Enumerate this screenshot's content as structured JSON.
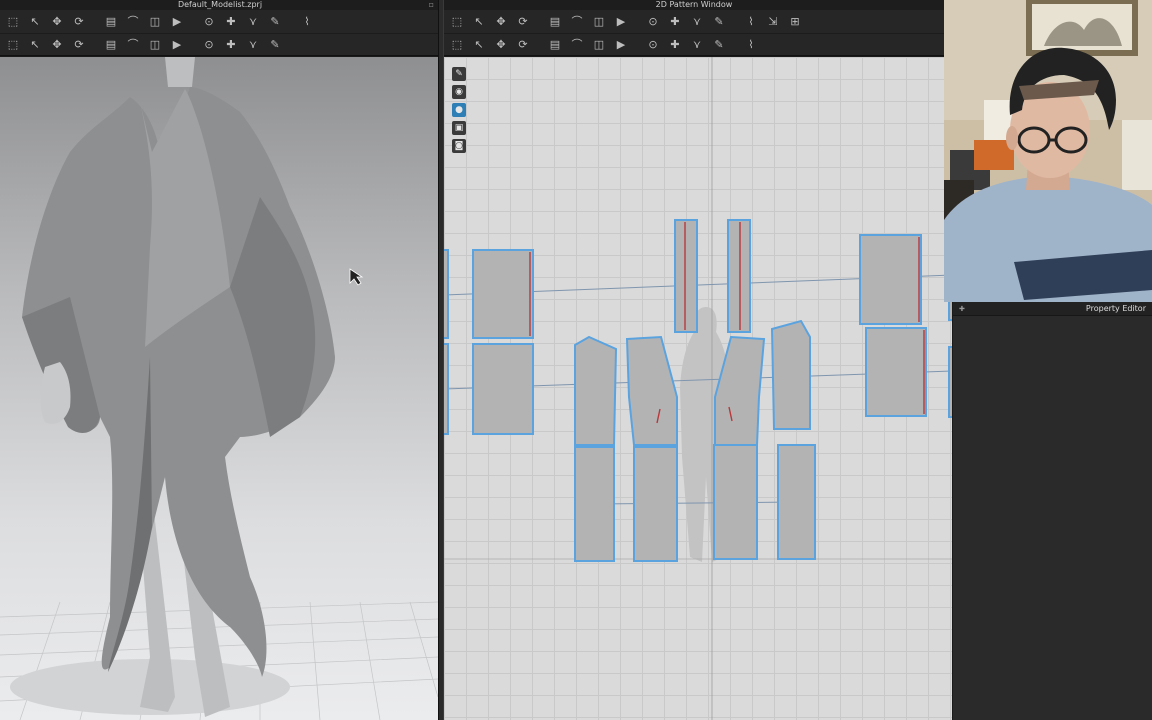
{
  "left_window": {
    "title": "Default_Modelist.zprj"
  },
  "right_window": {
    "title": "2D Pattern Window"
  },
  "property_editor": {
    "title": "Property Editor"
  },
  "toolbar3d": {
    "row1": [
      "select-box-icon",
      "transform-icon",
      "move-icon",
      "rotate-icon",
      "cloth-icon",
      "bend-icon",
      "layer-icon",
      "simulate-icon",
      "pin-icon",
      "tack-icon",
      "fold-icon",
      "pen-icon",
      "brush-icon"
    ],
    "row2": [
      "measure-icon",
      "gizmo-icon",
      "pin-box-icon",
      "hook-icon",
      "fold-arrange-icon",
      "snap-icon",
      "sphere-icon",
      "avatar-icon",
      "cut-icon",
      "paste-icon",
      "show-icon",
      "hide-icon"
    ]
  },
  "toolbar2d": {
    "row1": [
      "transform-pattern-icon",
      "edit-point-icon",
      "edit-curve-icon",
      "rectangle-icon",
      "internal-shape-icon",
      "dart-icon",
      "trace-icon",
      "flip-icon",
      "notch-icon",
      "segment-icon",
      "text-icon",
      "text-edit-icon",
      "grading-icon",
      "symmetry-icon",
      "pin-2d-icon"
    ],
    "row2": [
      "seam-icon",
      "free-seam-icon",
      "tack-2d-icon",
      "fold-2d-icon",
      "arrange-icon",
      "fabric-icon",
      "texture-icon",
      "graphic-icon",
      "topstitch-icon",
      "measure-2d-icon",
      "ruler-icon",
      "elastic-icon",
      "zipper-icon"
    ]
  },
  "side_tools": [
    "brush-tool-icon",
    "avatar-view-icon",
    "fabric-dot-icon",
    "overlay-icon",
    "camera-icon"
  ]
}
